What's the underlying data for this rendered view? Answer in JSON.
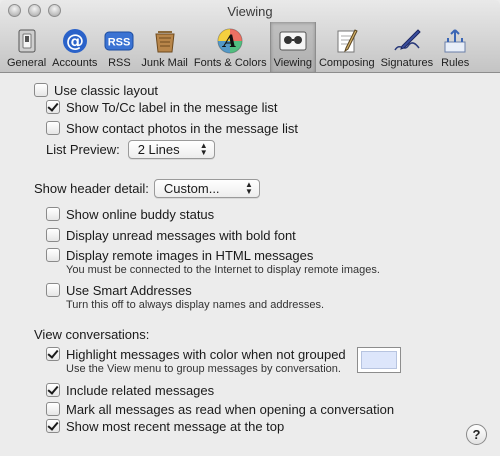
{
  "window": {
    "title": "Viewing"
  },
  "toolbar": {
    "items": [
      {
        "label": "General",
        "icon": "switch-icon"
      },
      {
        "label": "Accounts",
        "icon": "at-sign-icon"
      },
      {
        "label": "RSS",
        "icon": "rss-icon"
      },
      {
        "label": "Junk Mail",
        "icon": "junk-mail-icon"
      },
      {
        "label": "Fonts & Colors",
        "icon": "color-a-icon"
      },
      {
        "label": "Viewing",
        "icon": "viewing-icon",
        "selected": true
      },
      {
        "label": "Composing",
        "icon": "pen-paper-icon"
      },
      {
        "label": "Signatures",
        "icon": "signature-pen-icon"
      },
      {
        "label": "Rules",
        "icon": "rules-icon"
      }
    ]
  },
  "list": {
    "classic_layout": {
      "label": "Use classic layout",
      "checked": false
    },
    "to_cc_label": {
      "label": "Show To/Cc label in the message list",
      "checked": true
    },
    "contact_photos": {
      "label": "Show contact photos in the message list",
      "checked": false
    },
    "preview_label": "List Preview:",
    "preview_value": "2 Lines"
  },
  "header": {
    "detail_label": "Show header detail:",
    "detail_value": "Custom..."
  },
  "display": {
    "buddy_status": {
      "label": "Show online buddy status",
      "checked": false
    },
    "bold_unread": {
      "label": "Display unread messages with bold font",
      "checked": false
    },
    "remote_images": {
      "label": "Display remote images in HTML messages",
      "checked": false,
      "note": "You must be connected to the Internet to display remote images."
    },
    "smart_addresses": {
      "label": "Use Smart Addresses",
      "checked": false,
      "note": "Turn this off to always display names and addresses."
    }
  },
  "conversations": {
    "heading": "View conversations:",
    "highlight": {
      "label": "Highlight messages with color when not grouped",
      "checked": true,
      "note": "Use the View menu to group messages by conversation.",
      "color": "#dde6fb"
    },
    "related": {
      "label": "Include related messages",
      "checked": true
    },
    "mark_read": {
      "label": "Mark all messages as read when opening a conversation",
      "checked": false
    },
    "recent_top": {
      "label": "Show most recent message at the top",
      "checked": true
    }
  },
  "help": {
    "label": "?"
  }
}
